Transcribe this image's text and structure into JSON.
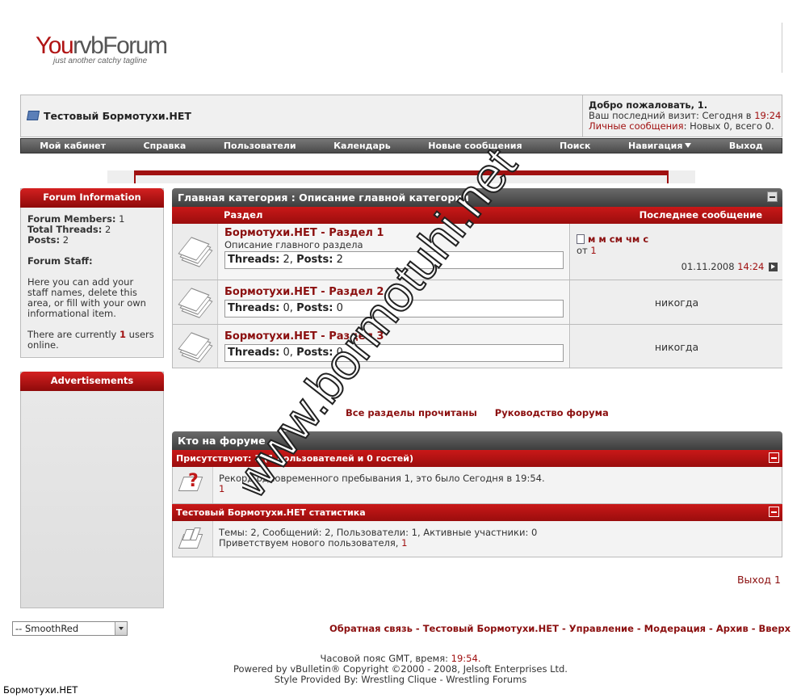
{
  "logo": {
    "part1": "You",
    "part2": "rvbForum",
    "tagline": "just another catchy tagline"
  },
  "nav": {
    "breadcrumb": "Тестовый Бормотухи.НЕТ",
    "welcome_prefix": "Добро пожаловать,",
    "welcome_user": "1",
    "last_visit_prefix": "Ваш последний визит: Сегодня в",
    "last_visit_time": "19:24",
    "pm_label": "Личные сообщения",
    "pm_text": ": Новых 0, всего 0."
  },
  "menu": [
    "Мой кабинет",
    "Справка",
    "Пользователи",
    "Календарь",
    "Новые сообщения",
    "Поиск",
    "Навигация",
    "Выход"
  ],
  "sidebar": {
    "info_title": "Forum Information",
    "members_label": "Forum Members:",
    "members": "1",
    "threads_label": "Total Threads:",
    "threads": "2",
    "posts_label": "Posts:",
    "posts": "2",
    "staff_label": "Forum Staff:",
    "staff_text": "Here you can add your staff names, delete this area, or fill with your own informational item.",
    "online_prefix": "There are currently",
    "online_count": "1",
    "online_suffix": "users online.",
    "ads_title": "Advertisements"
  },
  "category": {
    "title": "Главная категория : Описание главной категории",
    "col_forum": "Раздел",
    "col_last": "Последнее сообщение",
    "forums": [
      {
        "name": "Бормотухи.НЕТ - Раздел 1",
        "desc": "Описание главного раздела",
        "threads_label": "Threads:",
        "threads": "2",
        "posts_label": "Posts:",
        "posts": "2",
        "last_title": "м м см чм с",
        "last_by_prefix": "от",
        "last_by": "1",
        "last_date": "01.11.2008",
        "last_time": "14:24"
      },
      {
        "name": "Бормотухи.НЕТ - Раздел 2",
        "threads_label": "Threads:",
        "threads": "0",
        "posts_label": "Posts:",
        "posts": "0",
        "never": "никогда"
      },
      {
        "name": "Бормотухи.НЕТ - Раздел 3",
        "threads_label": "Threads:",
        "threads": "0",
        "posts_label": "Posts:",
        "posts": "0",
        "never": "никогда"
      }
    ]
  },
  "links": {
    "mark_read": "Все разделы прочитаны",
    "guide": "Руководство форума"
  },
  "online": {
    "title": "Кто на форуме",
    "present": "Присутствуют: 1 (1 пользователей и 0 гостей)",
    "record": "Рекорд одновременного пребывания 1, это было Сегодня в 19:54.",
    "user": "1",
    "stats_title": "Тестовый Бормотухи.НЕТ статистика",
    "stats": "Темы: 2, Сообщений: 2, Пользователи: 1, Активные участники: 0",
    "welcome_prefix": "Приветствуем нового пользователя,",
    "welcome_user": "1"
  },
  "logout": "Выход 1",
  "footer": {
    "style_selected": "-- SmoothRed",
    "links": "Обратная связь - Тестовый Бормотухи.НЕТ - Управление - Модерация - Архив - Вверх",
    "tz_prefix": "Часовой пояс GMT, время:",
    "tz_time": "19:54.",
    "powered": "Powered by vBulletin® Copyright ©2000 - 2008, Jelsoft Enterprises Ltd.",
    "style_by": "Style Provided By: Wrestling Clique - Wrestling Forums"
  },
  "watermark": "www.bormotuhi.net",
  "corner_label": "Бормотухи.НЕТ",
  "colors": {
    "accent": "#a01010",
    "menubar": "#555555",
    "link": "#8b0f0f"
  }
}
